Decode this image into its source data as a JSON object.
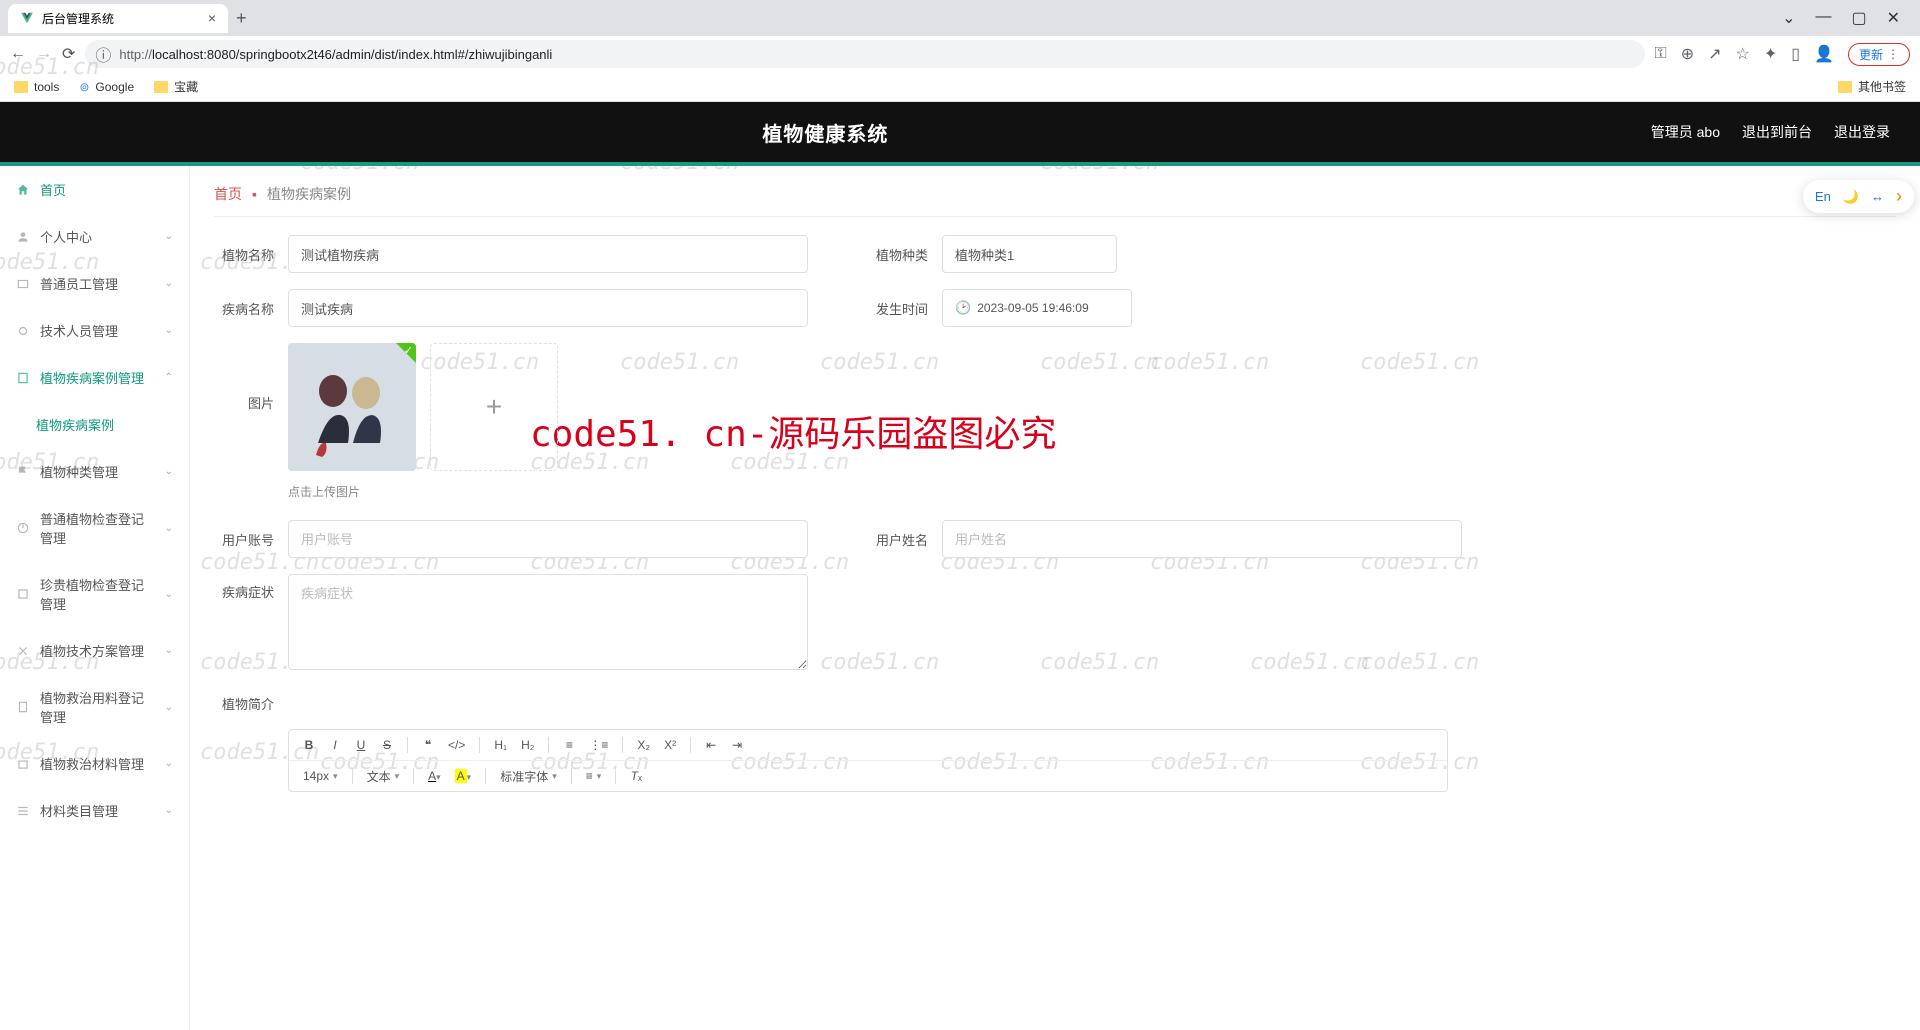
{
  "browser": {
    "tab_title": "后台管理系统",
    "url_prefix": "http://",
    "url_rest": "localhost:8080/springbootx2t46/admin/dist/index.html#/zhiwujibinganli",
    "update_label": "更新",
    "bookmarks": {
      "tools": "tools",
      "google": "Google",
      "baozang": "宝藏",
      "other": "其他书签"
    }
  },
  "topbar": {
    "title": "植物健康系统",
    "admin_role": "管理员 abo",
    "exit_front": "退出到前台",
    "logout": "退出登录"
  },
  "sidebar": {
    "items": [
      {
        "label": "首页"
      },
      {
        "label": "个人中心"
      },
      {
        "label": "普通员工管理"
      },
      {
        "label": "技术人员管理"
      },
      {
        "label": "植物疾病案例管理"
      },
      {
        "label": "植物疾病案例"
      },
      {
        "label": "植物种类管理"
      },
      {
        "label": "普通植物检查登记管理"
      },
      {
        "label": "珍贵植物检查登记管理"
      },
      {
        "label": "植物技术方案管理"
      },
      {
        "label": "植物救治用料登记管理"
      },
      {
        "label": "植物救治材料管理"
      },
      {
        "label": "材料类目管理"
      }
    ]
  },
  "breadcrumb": {
    "home": "首页",
    "current": "植物疾病案例"
  },
  "form": {
    "plant_name": {
      "label": "植物名称",
      "value": "测试植物疾病"
    },
    "plant_type": {
      "label": "植物种类",
      "value": "植物种类1"
    },
    "disease_name": {
      "label": "疾病名称",
      "value": "测试疾病"
    },
    "occur_time": {
      "label": "发生时间",
      "value": "2023-09-05 19:46:09"
    },
    "image": {
      "label": "图片",
      "hint": "点击上传图片"
    },
    "user_account": {
      "label": "用户账号",
      "placeholder": "用户账号"
    },
    "user_name": {
      "label": "用户姓名",
      "placeholder": "用户姓名"
    },
    "symptoms": {
      "label": "疾病症状",
      "placeholder": "疾病症状"
    },
    "intro": {
      "label": "植物简介"
    }
  },
  "editor": {
    "font_size": "14px",
    "text_label": "文本",
    "font_label": "标准字体"
  },
  "watermark": {
    "text": "code51.cn",
    "main": "code51. cn-源码乐园盗图必究"
  },
  "float": {
    "en": "En"
  }
}
